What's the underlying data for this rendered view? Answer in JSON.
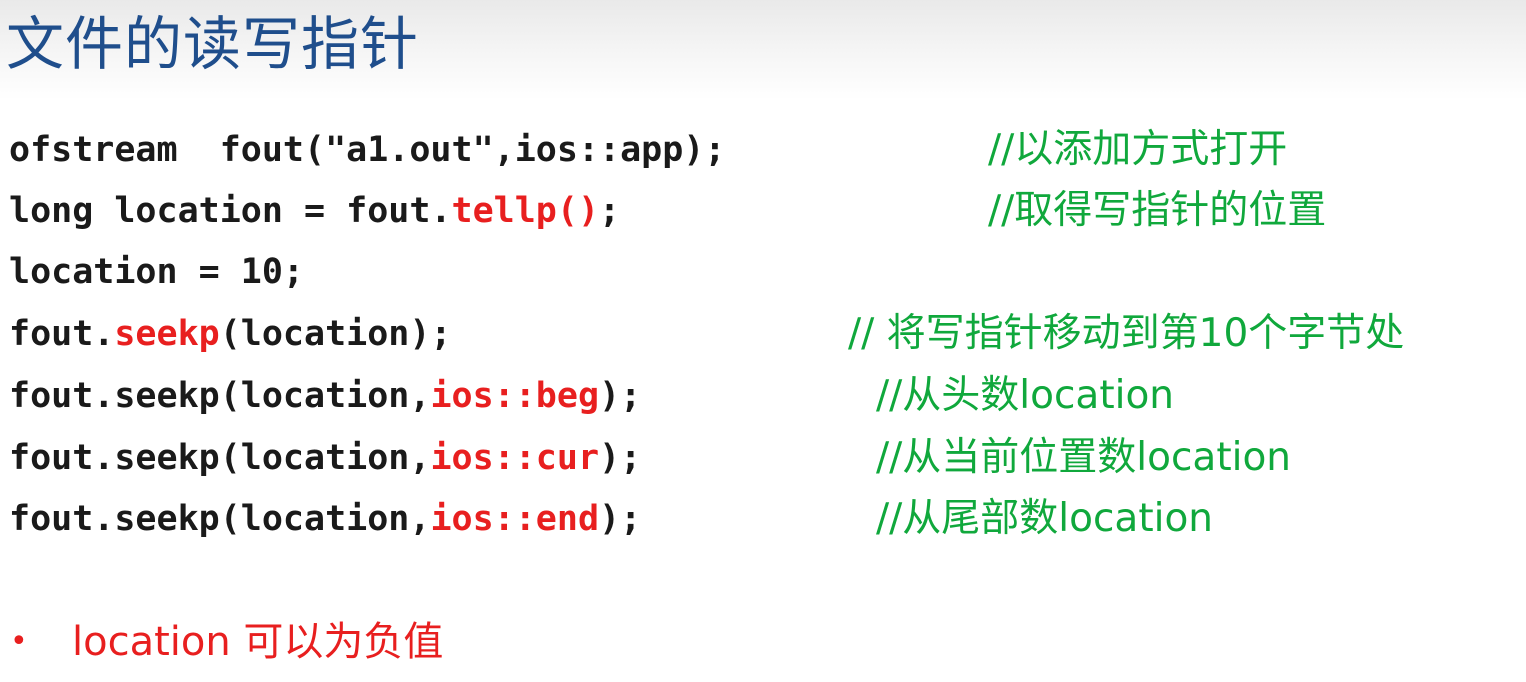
{
  "title": "文件的读写指针",
  "code": {
    "l1": {
      "text": "ofstream  fout(\"a1.out\",ios::app);",
      "comment": "//以添加方式打开"
    },
    "l2": {
      "a": "long location = fout.",
      "b": "tellp()",
      "c": ";",
      "comment": "//取得写指针的位置"
    },
    "l3": {
      "text": "location = 10;"
    },
    "l4": {
      "a": "fout.",
      "b": "seekp",
      "c": "(location);",
      "comment": "// 将写指针移动到第10个字节处"
    },
    "l5": {
      "a": "fout.seekp(location,",
      "b": "ios::beg",
      "c": ");",
      "comment": "//从头数location"
    },
    "l6": {
      "a": "fout.seekp(location,",
      "b": "ios::cur",
      "c": ");",
      "comment": "//从当前位置数location"
    },
    "l7": {
      "a": "fout.seekp(location,",
      "b": "ios::end",
      "c": ");",
      "comment": "//从尾部数location"
    }
  },
  "bullet": {
    "symbol": "•",
    "text": "location 可以为负值"
  },
  "colors": {
    "title": "#1f4e8c",
    "code": "#1a1a1a",
    "highlight": "#e81f1f",
    "comment": "#10a83c"
  }
}
